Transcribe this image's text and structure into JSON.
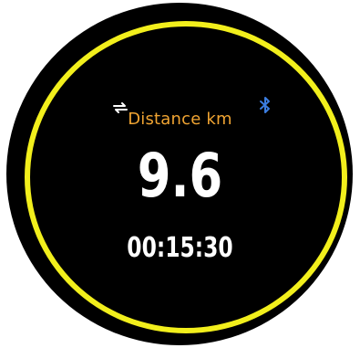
{
  "workout": {
    "metric_label": "Distance km",
    "metric_value": "9.6",
    "elapsed_time": "00:15:30"
  },
  "icons": {
    "sync": "sync-icon",
    "bluetooth": "bluetooth-icon"
  },
  "colors": {
    "ring": "#f2ef1c",
    "label": "#f0a432",
    "bluetooth": "#3b7de0",
    "text": "#ffffff",
    "background": "#000000"
  }
}
